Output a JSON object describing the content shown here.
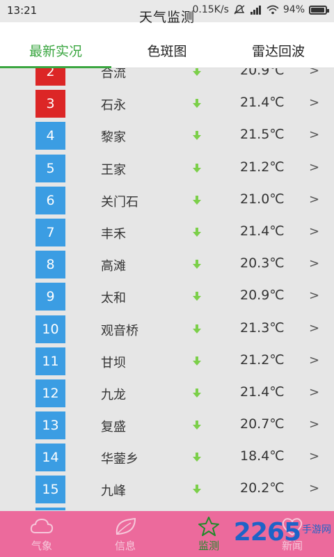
{
  "status_bar": {
    "time": "13:21",
    "network_speed": "0.15K/s",
    "battery": "94%"
  },
  "title": "天气监测",
  "tabs": [
    {
      "label": "最新实况",
      "active": true
    },
    {
      "label": "色斑图",
      "active": false
    },
    {
      "label": "雷达回波",
      "active": false
    }
  ],
  "rows": [
    {
      "rank": "2",
      "name": "合流",
      "temp": "20.9℃",
      "color": "#dc2626"
    },
    {
      "rank": "3",
      "name": "石永",
      "temp": "21.4℃",
      "color": "#dc2626"
    },
    {
      "rank": "4",
      "name": "黎家",
      "temp": "21.5℃",
      "color": "#3b9de3"
    },
    {
      "rank": "5",
      "name": "王家",
      "temp": "21.2℃",
      "color": "#3b9de3"
    },
    {
      "rank": "6",
      "name": "关门石",
      "temp": "21.0℃",
      "color": "#3b9de3"
    },
    {
      "rank": "7",
      "name": "丰禾",
      "temp": "21.4℃",
      "color": "#3b9de3"
    },
    {
      "rank": "8",
      "name": "高滩",
      "temp": "20.3℃",
      "color": "#3b9de3"
    },
    {
      "rank": "9",
      "name": "太和",
      "temp": "20.9℃",
      "color": "#3b9de3"
    },
    {
      "rank": "10",
      "name": "观音桥",
      "temp": "21.3℃",
      "color": "#3b9de3"
    },
    {
      "rank": "11",
      "name": "甘坝",
      "temp": "21.2℃",
      "color": "#3b9de3"
    },
    {
      "rank": "12",
      "name": "九龙",
      "temp": "21.4℃",
      "color": "#3b9de3"
    },
    {
      "rank": "13",
      "name": "复盛",
      "temp": "20.7℃",
      "color": "#3b9de3"
    },
    {
      "rank": "14",
      "name": "华蓥乡",
      "temp": "18.4℃",
      "color": "#3b9de3"
    },
    {
      "rank": "15",
      "name": "九峰",
      "temp": "20.2℃",
      "color": "#3b9de3"
    }
  ],
  "chevron": ">",
  "bottom_nav": [
    {
      "label": "气象",
      "icon": "cloud-icon",
      "active": false
    },
    {
      "label": "信息",
      "icon": "leaf-icon",
      "active": false
    },
    {
      "label": "监测",
      "icon": "star-icon",
      "active": true
    },
    {
      "label": "新闻",
      "icon": "heart-icon",
      "active": false
    }
  ],
  "watermark": {
    "number": "2265",
    "text": "手游网"
  },
  "colors": {
    "accent_green": "#3aa640",
    "rank_red": "#dc2626",
    "rank_blue": "#3b9de3",
    "nav_pink": "#ec6a9c"
  }
}
